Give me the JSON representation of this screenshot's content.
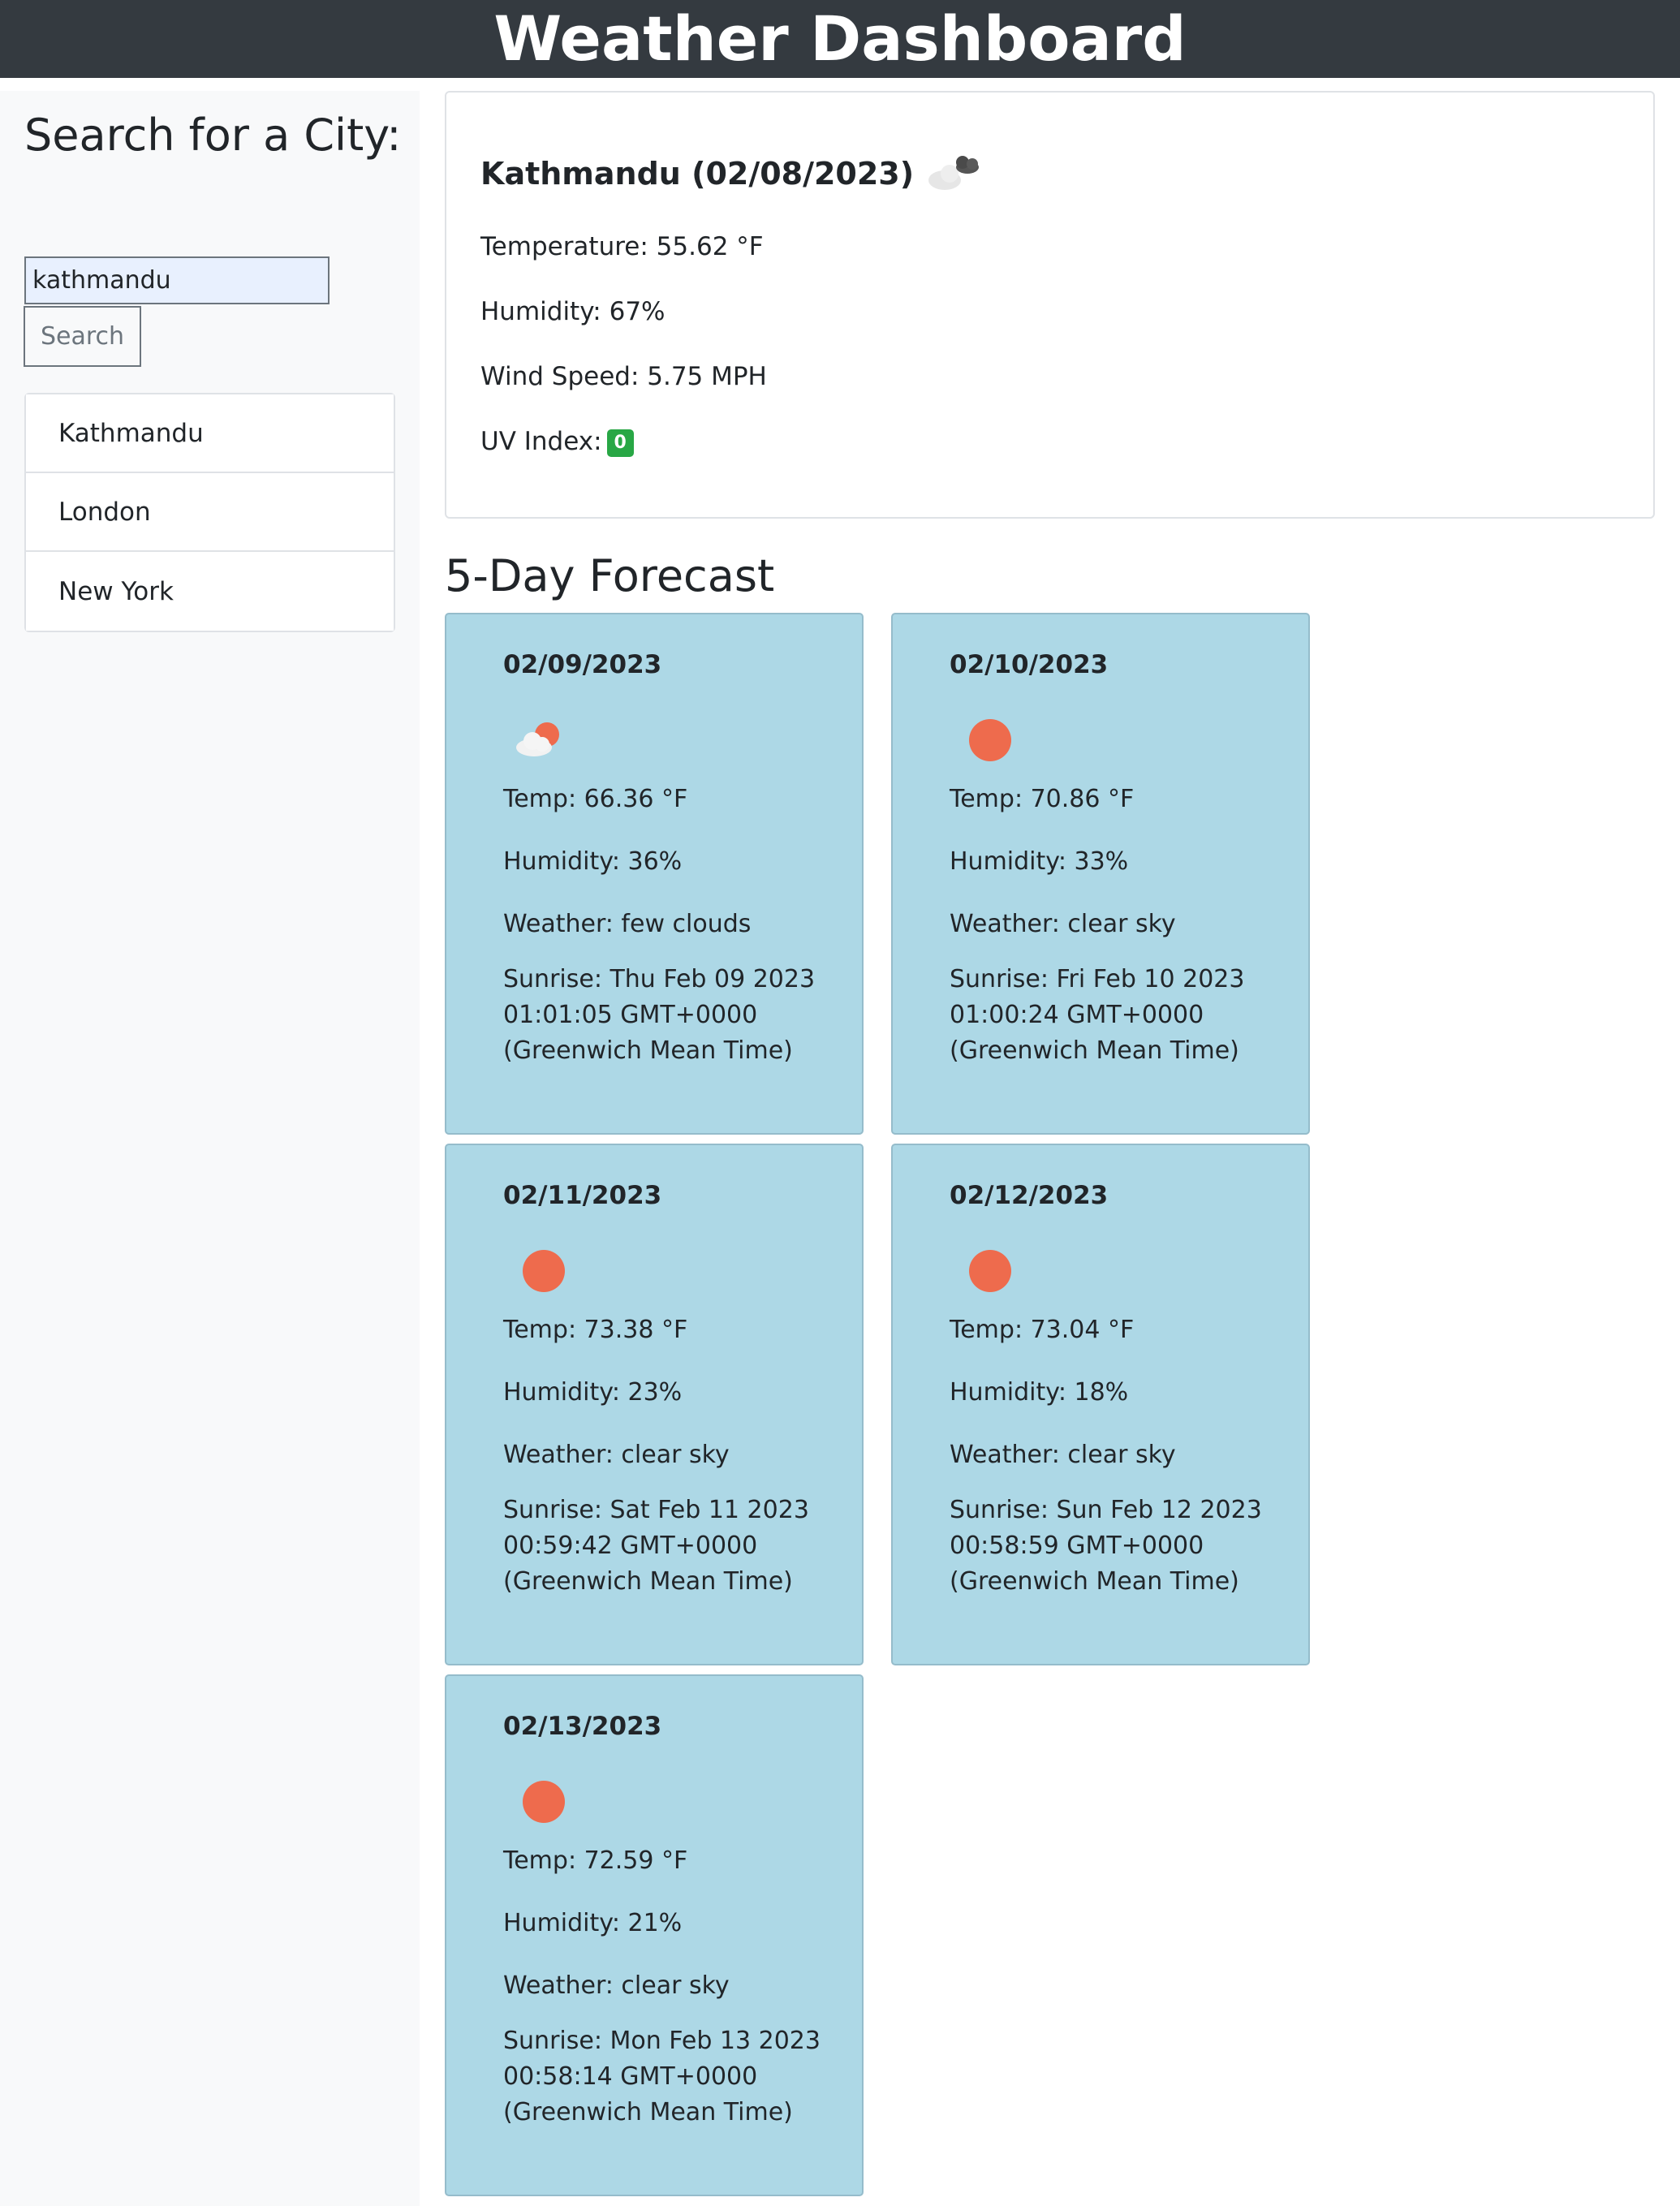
{
  "header": {
    "title": "Weather Dashboard"
  },
  "sidebar": {
    "heading": "Search for a City:",
    "search_value": "kathmandu",
    "search_button": "Search",
    "history": [
      "Kathmandu",
      "London",
      "New York"
    ]
  },
  "current": {
    "title": "Kathmandu (02/08/2023)",
    "icon": "broken-clouds-icon",
    "temperature": "Temperature: 55.62 °F",
    "humidity": "Humidity: 67%",
    "wind": "Wind Speed: 5.75 MPH",
    "uv_label": "UV Index:",
    "uv_value": "0",
    "uv_color": "#28a745"
  },
  "forecast": {
    "heading": "5-Day Forecast",
    "days": [
      {
        "date": "02/09/2023",
        "icon": "few-clouds-icon",
        "temp": "Temp: 66.36 °F",
        "humidity": "Humidity: 36%",
        "weather": "Weather: few clouds",
        "sunrise": "Sunrise: Thu Feb 09 2023 01:01:05 GMT+0000 (Greenwich Mean Time)"
      },
      {
        "date": "02/10/2023",
        "icon": "sun-icon",
        "temp": "Temp: 70.86 °F",
        "humidity": "Humidity: 33%",
        "weather": "Weather: clear sky",
        "sunrise": "Sunrise: Fri Feb 10 2023 01:00:24 GMT+0000 (Greenwich Mean Time)"
      },
      {
        "date": "02/11/2023",
        "icon": "sun-icon",
        "temp": "Temp: 73.38 °F",
        "humidity": "Humidity: 23%",
        "weather": "Weather: clear sky",
        "sunrise": "Sunrise: Sat Feb 11 2023 00:59:42 GMT+0000 (Greenwich Mean Time)"
      },
      {
        "date": "02/12/2023",
        "icon": "sun-icon",
        "temp": "Temp: 73.04 °F",
        "humidity": "Humidity: 18%",
        "weather": "Weather: clear sky",
        "sunrise": "Sunrise: Sun Feb 12 2023 00:58:59 GMT+0000 (Greenwich Mean Time)"
      },
      {
        "date": "02/13/2023",
        "icon": "sun-icon",
        "temp": "Temp: 72.59 °F",
        "humidity": "Humidity: 21%",
        "weather": "Weather: clear sky",
        "sunrise": "Sunrise: Mon Feb 13 2023 00:58:14 GMT+0000 (Greenwich Mean Time)"
      }
    ]
  },
  "colors": {
    "header_bg": "#343a40",
    "sidebar_bg": "#f8f9fa",
    "card_bg": "#add8e6",
    "sun": "#ee6b4d"
  }
}
